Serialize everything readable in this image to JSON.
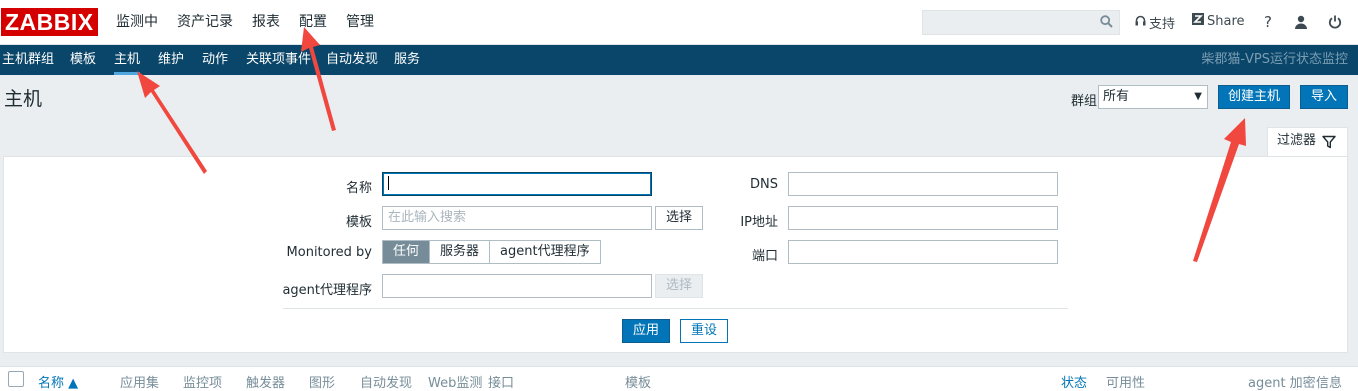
{
  "header": {
    "logo": "ZABBIX",
    "main_menu": [
      {
        "label": "监测中",
        "selected": false
      },
      {
        "label": "资产记录",
        "selected": false
      },
      {
        "label": "报表",
        "selected": false
      },
      {
        "label": "配置",
        "selected": true
      },
      {
        "label": "管理",
        "selected": false
      }
    ],
    "search_placeholder": "",
    "support_label": "支持",
    "share_label": "Share",
    "help_label": "?"
  },
  "sub_menu": {
    "items": [
      {
        "label": "主机群组",
        "selected": false
      },
      {
        "label": "模板",
        "selected": false
      },
      {
        "label": "主机",
        "selected": true
      },
      {
        "label": "维护",
        "selected": false
      },
      {
        "label": "动作",
        "selected": false
      },
      {
        "label": "关联项事件",
        "selected": false
      },
      {
        "label": "自动发现",
        "selected": false
      },
      {
        "label": "服务",
        "selected": false
      }
    ],
    "server_name": "柴郡猫-VPS运行状态监控"
  },
  "page": {
    "title": "主机",
    "group_label": "群组",
    "group_value": "所有",
    "create_button": "创建主机",
    "import_button": "导入"
  },
  "filter": {
    "tab_label": "过滤器",
    "name_label": "名称",
    "name_value": "",
    "template_label": "模板",
    "template_placeholder": "在此输入搜索",
    "template_select_button": "选择",
    "monitored_by_label": "Monitored by",
    "monitored_by_options": [
      {
        "label": "任何",
        "selected": true
      },
      {
        "label": "服务器",
        "selected": false
      },
      {
        "label": "agent代理程序",
        "selected": false
      }
    ],
    "proxy_label": "agent代理程序",
    "proxy_value": "",
    "proxy_select_button": "选择",
    "dns_label": "DNS",
    "dns_value": "",
    "ip_label": "IP地址",
    "ip_value": "",
    "port_label": "端口",
    "port_value": "",
    "apply_button": "应用",
    "reset_button": "重设"
  },
  "table": {
    "columns": [
      {
        "label": "名称 ▲",
        "link": true
      },
      {
        "label": "应用集",
        "link": false
      },
      {
        "label": "监控项",
        "link": false
      },
      {
        "label": "触发器",
        "link": false
      },
      {
        "label": "图形",
        "link": false
      },
      {
        "label": "自动发现",
        "link": false
      },
      {
        "label": "Web监测",
        "link": false
      },
      {
        "label": "接口",
        "link": false
      },
      {
        "label": "模板",
        "link": false
      },
      {
        "label": "状态",
        "link": true
      },
      {
        "label": "可用性",
        "link": false
      },
      {
        "label": "agent 加密",
        "link": false
      },
      {
        "label": "信息",
        "link": false
      }
    ]
  },
  "colors": {
    "brand_red": "#d40000",
    "nav_blue": "#0a466a",
    "accent_blue": "#0275b8",
    "annotation_arrow": "#f0483e"
  },
  "icons": [
    "search-icon",
    "headset-icon",
    "share-icon",
    "user-icon",
    "power-icon",
    "filter-icon",
    "dropdown-arrow-icon",
    "annotation-arrow"
  ]
}
